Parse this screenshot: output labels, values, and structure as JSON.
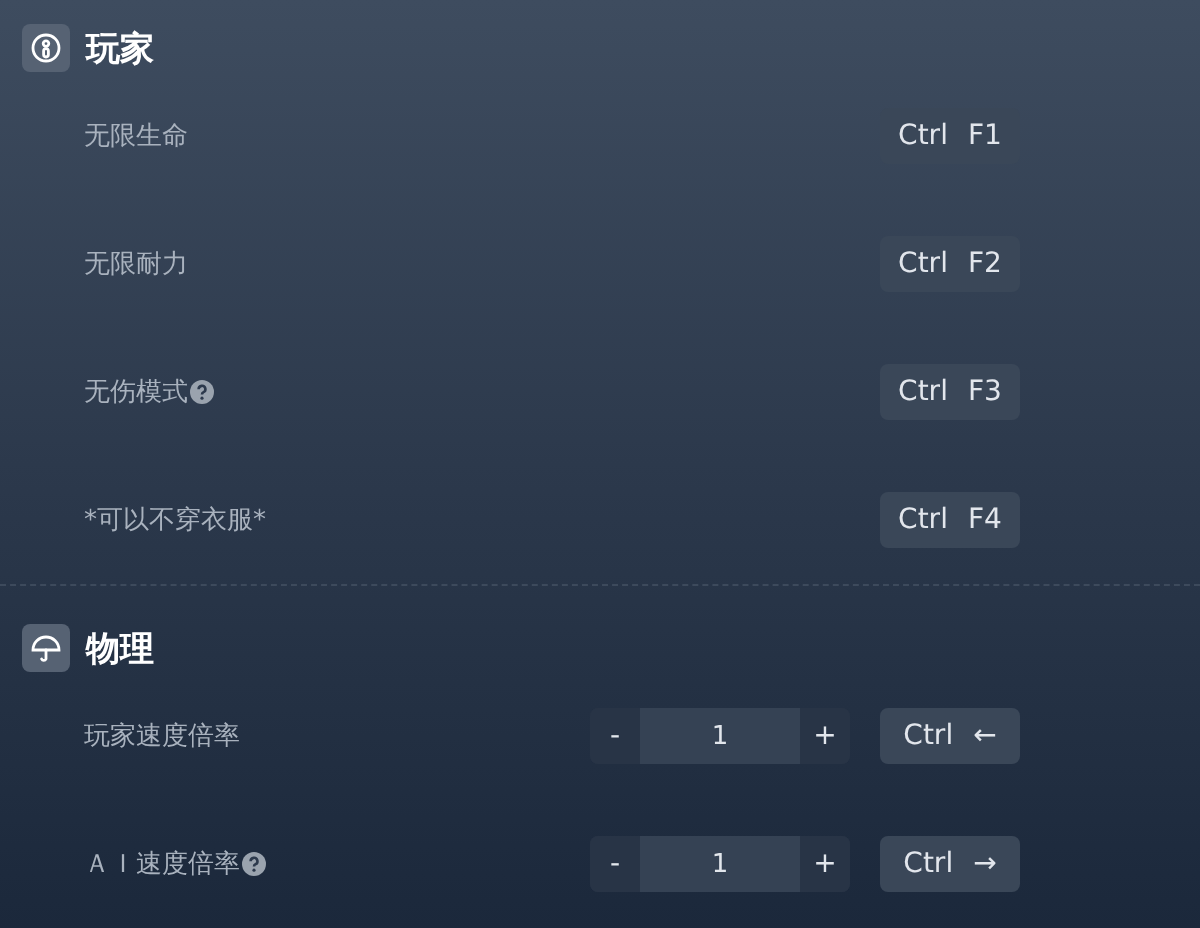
{
  "sections": [
    {
      "title": "玩家",
      "rows": [
        {
          "kind": "toggle",
          "label": "无限生命",
          "help": false,
          "keys": [
            "Ctrl",
            "F1"
          ]
        },
        {
          "kind": "toggle",
          "label": "无限耐力",
          "help": false,
          "keys": [
            "Ctrl",
            "F2"
          ]
        },
        {
          "kind": "toggle",
          "label": "无伤模式",
          "help": true,
          "keys": [
            "Ctrl",
            "F3"
          ]
        },
        {
          "kind": "toggle",
          "label": "*可以不穿衣服*",
          "help": false,
          "keys": [
            "Ctrl",
            "F4"
          ]
        }
      ]
    },
    {
      "title": "物理",
      "rows": [
        {
          "kind": "stepper",
          "label": "玩家速度倍率",
          "help": false,
          "decrement": "-",
          "value": "1",
          "increment": "+",
          "keys": [
            "Ctrl",
            "←"
          ]
        },
        {
          "kind": "stepper",
          "label": "ＡＩ速度倍率",
          "help": true,
          "decrement": "-",
          "value": "1",
          "increment": "+",
          "keys": [
            "Ctrl",
            "→"
          ]
        }
      ]
    }
  ]
}
